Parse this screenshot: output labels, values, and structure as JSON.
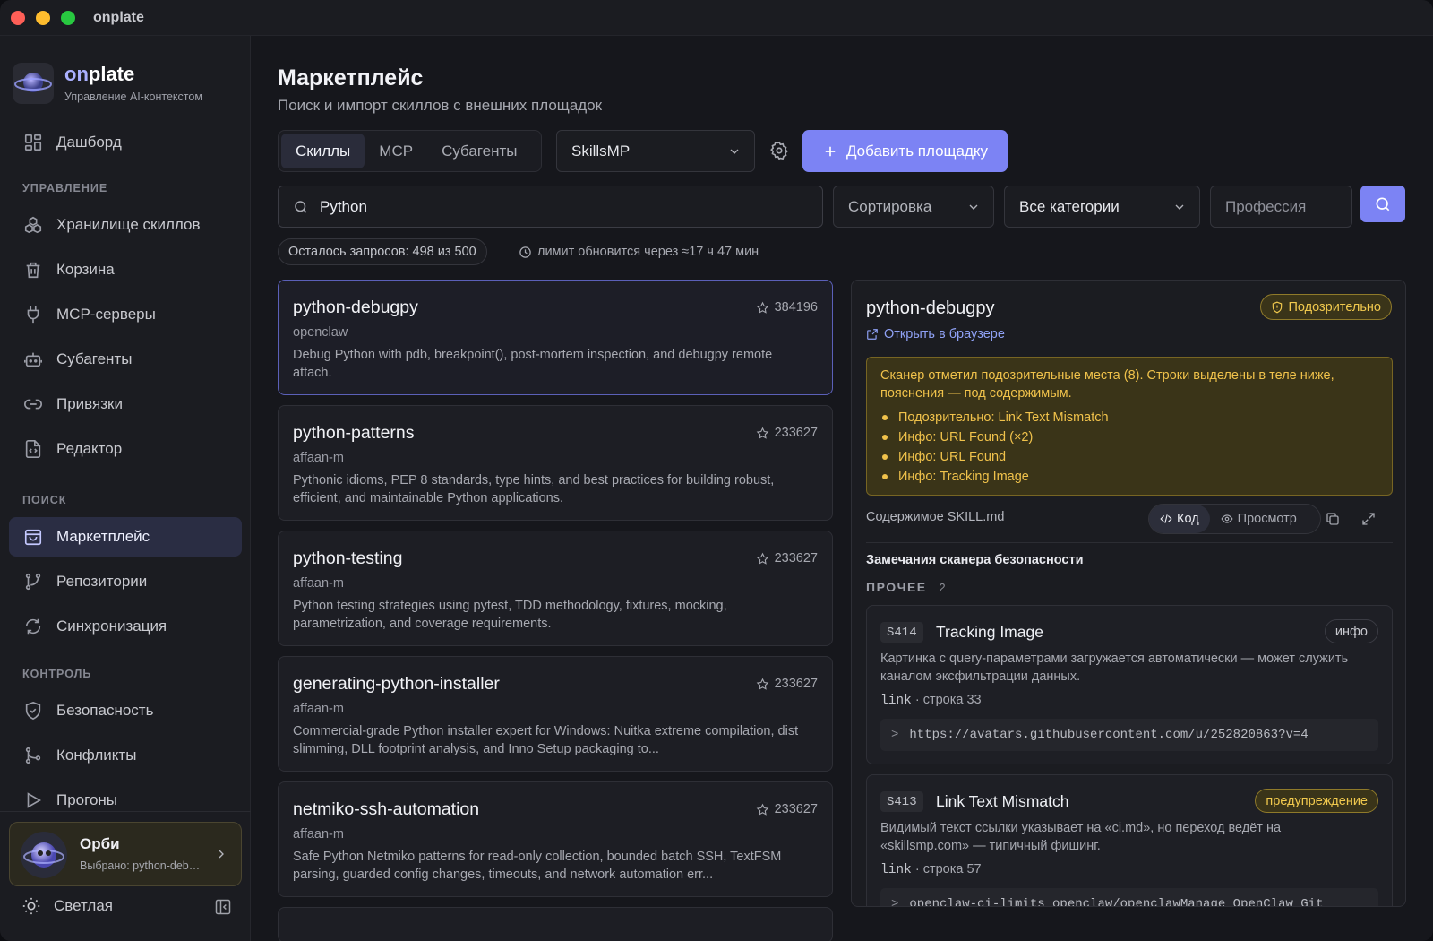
{
  "window": {
    "title": "onplate"
  },
  "brand": {
    "name_prefix": "on",
    "name_suffix": "plate",
    "subtitle": "Управление AI-контекстом"
  },
  "sidebar": {
    "items": [
      {
        "label": "Дашборд",
        "icon": "dashboard-icon"
      },
      {
        "label": "Хранилище скиллов",
        "icon": "cube-stack-icon"
      },
      {
        "label": "Корзина",
        "icon": "trash-icon"
      },
      {
        "label": "MCP-серверы",
        "icon": "plug-icon"
      },
      {
        "label": "Субагенты",
        "icon": "robot-icon"
      },
      {
        "label": "Привязки",
        "icon": "link-icon"
      },
      {
        "label": "Редактор",
        "icon": "file-code-icon"
      },
      {
        "label": "Маркетплейс",
        "icon": "shopping-bag-icon",
        "active": true
      },
      {
        "label": "Репозитории",
        "icon": "git-branch-icon"
      },
      {
        "label": "Синхронизация",
        "icon": "refresh-icon"
      },
      {
        "label": "Безопасность",
        "icon": "shield-icon"
      },
      {
        "label": "Конфликты",
        "icon": "git-merge-icon"
      },
      {
        "label": "Прогоны",
        "icon": "play-icon"
      }
    ],
    "sections": {
      "manage": "УПРАВЛЕНИЕ",
      "search": "ПОИСК",
      "control": "КОНТРОЛЬ"
    },
    "orbi": {
      "name": "Орби",
      "selected": "Выбрано: python-debugpy"
    },
    "theme_label": "Светлая"
  },
  "page": {
    "title": "Маркетплейс",
    "subtitle": "Поиск и импорт скиллов с внешних площадок"
  },
  "tabs": [
    {
      "label": "Скиллы",
      "active": true
    },
    {
      "label": "MCP"
    },
    {
      "label": "Субагенты"
    }
  ],
  "marketplace_select": "SkillsMP",
  "add_button": "Добавить площадку",
  "search": {
    "value": "Python",
    "sort_label": "Сортировка",
    "category_label": "Все категории",
    "profession_placeholder": "Профессия"
  },
  "quota": {
    "remaining": "Осталось запросов: 498 из 500",
    "reset": "лимит обновится через ≈17 ч 47 мин"
  },
  "results": [
    {
      "name": "python-debugpy",
      "author": "openclaw",
      "stars": "384196",
      "desc": "Debug Python with pdb, breakpoint(), post-mortem inspection, and debugpy remote attach."
    },
    {
      "name": "python-patterns",
      "author": "affaan-m",
      "stars": "233627",
      "desc": "Pythonic idioms, PEP 8 standards, type hints, and best practices for building robust, efficient, and maintainable Python applications."
    },
    {
      "name": "python-testing",
      "author": "affaan-m",
      "stars": "233627",
      "desc": "Python testing strategies using pytest, TDD methodology, fixtures, mocking, parametrization, and coverage requirements."
    },
    {
      "name": "generating-python-installer",
      "author": "affaan-m",
      "stars": "233627",
      "desc": "Commercial-grade Python installer expert for Windows: Nuitka extreme compilation, dist slimming, DLL footprint analysis, and Inno Setup packaging to..."
    },
    {
      "name": "netmiko-ssh-automation",
      "author": "affaan-m",
      "stars": "233627",
      "desc": "Safe Python Netmiko patterns for read-only collection, bounded batch SSH, TextFSM parsing, guarded config changes, timeouts, and network automation err..."
    }
  ],
  "detail": {
    "title": "python-debugpy",
    "open_link": "Открыть в браузере",
    "badge": "Подозрительно",
    "warning_text": "Сканер отметил подозрительные места (8). Строки выделены в теле ниже, пояснения — под содержимым.",
    "warning_items": [
      "Подозрительно: Link Text Mismatch",
      "Инфо: URL Found (×2)",
      "Инфо: URL Found",
      "Инфо: Tracking Image"
    ],
    "content_label": "Содержимое SKILL.md",
    "view_code": "Код",
    "view_preview": "Просмотр",
    "scanner_title": "Замечания сканера безопасности",
    "group_label": "ПРОЧЕЕ",
    "group_count": "2",
    "issues": [
      {
        "code": "S414",
        "title": "Tracking Image",
        "severity": "инфо",
        "desc": "Картинка с query-параметрами загружается автоматически — может служить каналом эксфильтрации данных.",
        "kind": "link",
        "line": "· строка 33",
        "snippet": "https://avatars.githubusercontent.com/u/252820863?v=4"
      },
      {
        "code": "S413",
        "title": "Link Text Mismatch",
        "severity": "предупреждение",
        "desc": "Видимый текст ссылки указывает на «ci.md», но переход ведёт на «skillsmp.com» — типичный фишинг.",
        "kind": "link",
        "line": "· строка 57",
        "snippet": "openclaw-ci-limits openclaw/openclawManage OpenClaw Git"
      }
    ]
  },
  "colors": {
    "accent": "#7c83f4",
    "warning": "#f0c24b",
    "background": "#16171c"
  }
}
